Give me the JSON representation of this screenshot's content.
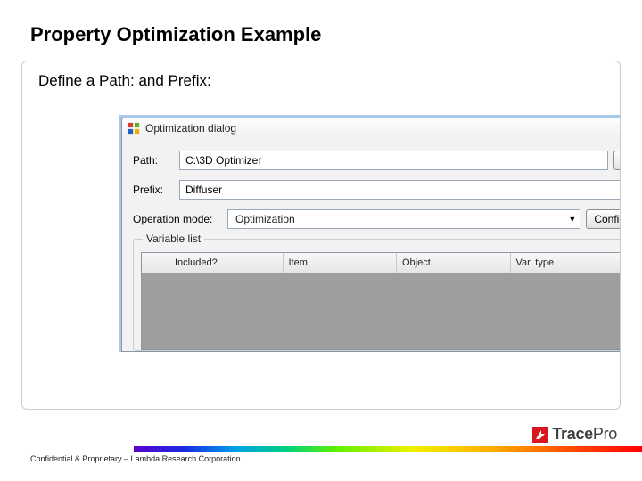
{
  "slide": {
    "title": "Property Optimization Example",
    "subtitle": "Define a Path: and Prefix:"
  },
  "dialog": {
    "title": "Optimization dialog",
    "path": {
      "label": "Path:",
      "value": "C:\\3D Optimizer",
      "browse_button": "B"
    },
    "prefix": {
      "label": "Prefix:",
      "value": "Diffuser"
    },
    "operation_mode": {
      "label": "Operation mode:",
      "selected": "Optimization",
      "config_button": "Config"
    },
    "variable_list": {
      "group_title": "Variable list",
      "columns": {
        "included": "Included?",
        "item": "Item",
        "object": "Object",
        "var_type": "Var. type"
      }
    }
  },
  "footer": {
    "confidential": "Confidential & Proprietary – Lambda Research Corporation",
    "logo_text_a": "Trace",
    "logo_text_b": "Pro"
  }
}
